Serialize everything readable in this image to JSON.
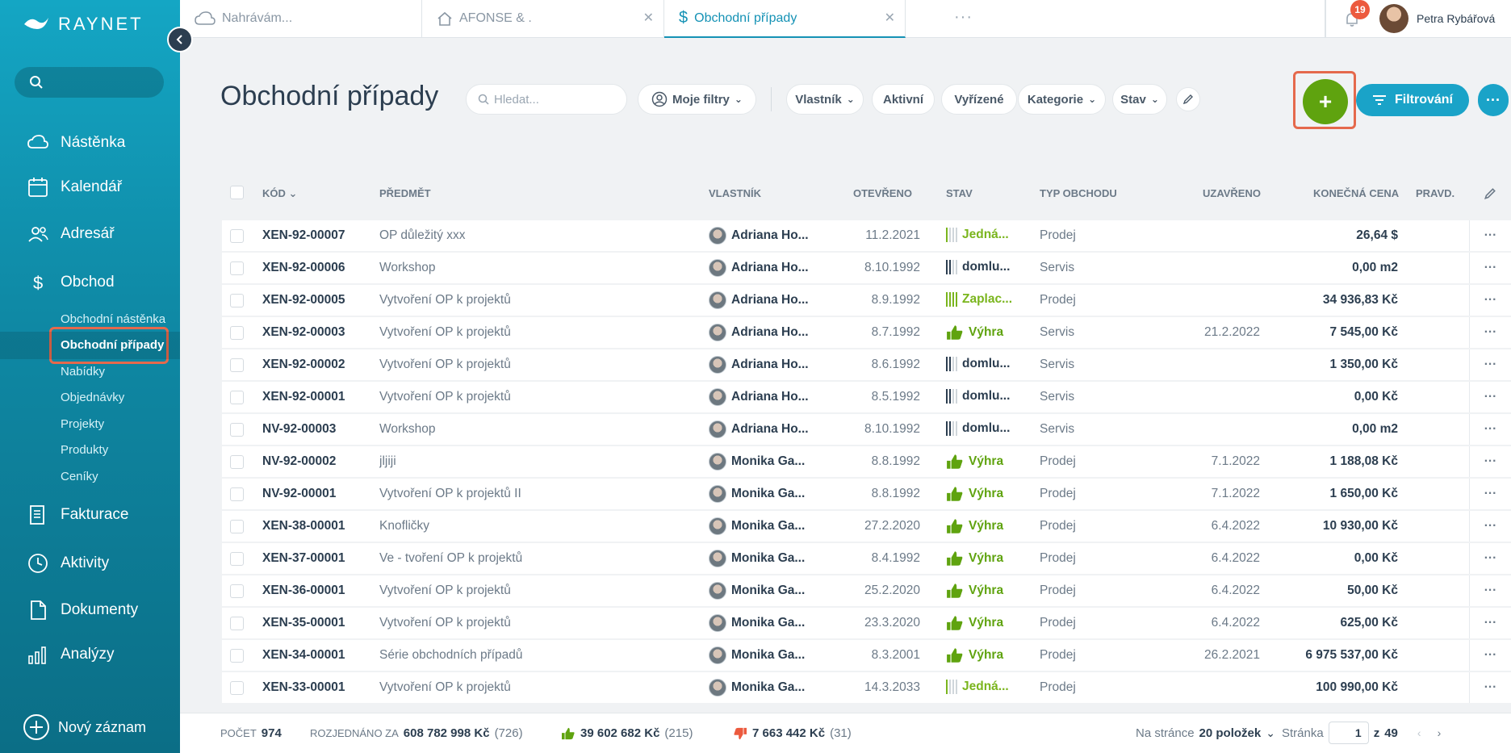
{
  "app": {
    "brand": "RAYNET"
  },
  "tabs": [
    {
      "label": "Nahrávám..."
    },
    {
      "label": "AFONSE & ."
    },
    {
      "label": "Obchodní případy"
    }
  ],
  "notifications": {
    "count": "19"
  },
  "user": {
    "name": "Petra Rybářová"
  },
  "sidebar": {
    "items": [
      {
        "label": "Nástěnka"
      },
      {
        "label": "Kalendář"
      },
      {
        "label": "Adresář"
      },
      {
        "label": "Obchod"
      },
      {
        "label": "Fakturace"
      },
      {
        "label": "Aktivity"
      },
      {
        "label": "Dokumenty"
      },
      {
        "label": "Analýzy"
      }
    ],
    "subitems": [
      {
        "label": "Obchodní nástěnka"
      },
      {
        "label": "Obchodní případy"
      },
      {
        "label": "Nabídky"
      },
      {
        "label": "Objednávky"
      },
      {
        "label": "Projekty"
      },
      {
        "label": "Produkty"
      },
      {
        "label": "Ceníky"
      }
    ],
    "new_record": "Nový záznam"
  },
  "header": {
    "title": "Obchodní případy",
    "search_placeholder": "Hledat...",
    "my_filters": "Moje filtry",
    "filters": [
      "Vlastník",
      "Aktivní",
      "Vyřízené",
      "Kategorie",
      "Stav"
    ],
    "add_label": "+",
    "filter_button": "Filtrování"
  },
  "table": {
    "columns": [
      "KÓD",
      "PŘEDMĚT",
      "VLASTNÍK",
      "OTEVŘENO",
      "STAV",
      "TYP OBCHODU",
      "UZAVŘENO",
      "KONEČNÁ CENA",
      "PRAVD."
    ],
    "rows": [
      {
        "code": "XEN-92-00007",
        "subject": "OP důležitý xxx",
        "owner": "Adriana Ho...",
        "opened": "11.2.2021",
        "state": "Jedná...",
        "state_kind": "negotiation",
        "type": "Prodej",
        "closed": "",
        "price": "26,64 $"
      },
      {
        "code": "XEN-92-00006",
        "subject": "Workshop",
        "owner": "Adriana Ho...",
        "opened": "8.10.1992",
        "state": "domlu...",
        "state_kind": "agreed",
        "type": "Servis",
        "closed": "",
        "price": "0,00 m2"
      },
      {
        "code": "XEN-92-00005",
        "subject": "Vytvoření OP k projektů",
        "owner": "Adriana Ho...",
        "opened": "8.9.1992",
        "state": "Zaplac...",
        "state_kind": "paid",
        "type": "Prodej",
        "closed": "",
        "price": "34 936,83 Kč"
      },
      {
        "code": "XEN-92-00003",
        "subject": "Vytvoření OP k projektů",
        "owner": "Adriana Ho...",
        "opened": "8.7.1992",
        "state": "Výhra",
        "state_kind": "win",
        "type": "Servis",
        "closed": "21.2.2022",
        "price": "7 545,00 Kč"
      },
      {
        "code": "XEN-92-00002",
        "subject": "Vytvoření OP k projektů",
        "owner": "Adriana Ho...",
        "opened": "8.6.1992",
        "state": "domlu...",
        "state_kind": "agreed",
        "type": "Servis",
        "closed": "",
        "price": "1 350,00 Kč"
      },
      {
        "code": "XEN-92-00001",
        "subject": "Vytvoření OP k projektů",
        "owner": "Adriana Ho...",
        "opened": "8.5.1992",
        "state": "domlu...",
        "state_kind": "agreed",
        "type": "Servis",
        "closed": "",
        "price": "0,00 Kč"
      },
      {
        "code": "NV-92-00003",
        "subject": "Workshop",
        "owner": "Adriana Ho...",
        "opened": "8.10.1992",
        "state": "domlu...",
        "state_kind": "agreed",
        "type": "Servis",
        "closed": "",
        "price": "0,00 m2"
      },
      {
        "code": "NV-92-00002",
        "subject": "jljiji",
        "owner": "Monika Ga...",
        "opened": "8.8.1992",
        "state": "Výhra",
        "state_kind": "win",
        "type": "Prodej",
        "closed": "7.1.2022",
        "price": "1 188,08 Kč"
      },
      {
        "code": "NV-92-00001",
        "subject": "Vytvoření OP k projektů II",
        "owner": "Monika Ga...",
        "opened": "8.8.1992",
        "state": "Výhra",
        "state_kind": "win",
        "type": "Prodej",
        "closed": "7.1.2022",
        "price": "1 650,00 Kč"
      },
      {
        "code": "XEN-38-00001",
        "subject": "Knofličky",
        "owner": "Monika Ga...",
        "opened": "27.2.2020",
        "state": "Výhra",
        "state_kind": "win",
        "type": "Prodej",
        "closed": "6.4.2022",
        "price": "10 930,00 Kč"
      },
      {
        "code": "XEN-37-00001",
        "subject": "Ve - tvoření OP k projektů",
        "owner": "Monika Ga...",
        "opened": "8.4.1992",
        "state": "Výhra",
        "state_kind": "win",
        "type": "Prodej",
        "closed": "6.4.2022",
        "price": "0,00 Kč"
      },
      {
        "code": "XEN-36-00001",
        "subject": "Vytvoření OP k projektů",
        "owner": "Monika Ga...",
        "opened": "25.2.2020",
        "state": "Výhra",
        "state_kind": "win",
        "type": "Prodej",
        "closed": "6.4.2022",
        "price": "50,00 Kč"
      },
      {
        "code": "XEN-35-00001",
        "subject": "Vytvoření OP k projektů",
        "owner": "Monika Ga...",
        "opened": "23.3.2020",
        "state": "Výhra",
        "state_kind": "win",
        "type": "Prodej",
        "closed": "6.4.2022",
        "price": "625,00 Kč"
      },
      {
        "code": "XEN-34-00001",
        "subject": "Série obchodních případů",
        "owner": "Monika Ga...",
        "opened": "8.3.2001",
        "state": "Výhra",
        "state_kind": "win",
        "type": "Prodej",
        "closed": "26.2.2021",
        "price": "6 975 537,00 Kč"
      },
      {
        "code": "XEN-33-00001",
        "subject": "Vytvoření OP k projektů",
        "owner": "Monika Ga...",
        "opened": "14.3.2033",
        "state": "Jedná...",
        "state_kind": "negotiation",
        "type": "Prodej",
        "closed": "",
        "price": "100 990,00 Kč"
      }
    ]
  },
  "footer": {
    "count_label": "POČET",
    "count": "974",
    "negotiated_label": "ROZJEDNÁNO ZA",
    "negotiated_value": "608 782 998 Kč",
    "negotiated_count": "(726)",
    "won_value": "39 602 682 Kč",
    "won_count": "(215)",
    "lost_value": "7 663 442 Kč",
    "lost_count": "(31)",
    "per_page_label": "Na stránce",
    "per_page_value": "20 položek",
    "page_label": "Stránka",
    "page_value": "1",
    "of_label": "z",
    "total_pages": "49"
  },
  "colors": {
    "accent": "#1aa3c8",
    "add_green": "#5fa30f",
    "win_green": "#5fa30f",
    "lost_red": "#ec5a3e",
    "highlight": "#e5694c"
  },
  "icons": [
    "cloud-icon",
    "home-icon",
    "dollar-icon",
    "bell-icon",
    "search-icon",
    "user-filter-icon",
    "pencil-icon",
    "filter-icon",
    "thumbs-up-icon",
    "thumbs-down-icon",
    "chevron-left-icon",
    "chevron-right-icon"
  ]
}
